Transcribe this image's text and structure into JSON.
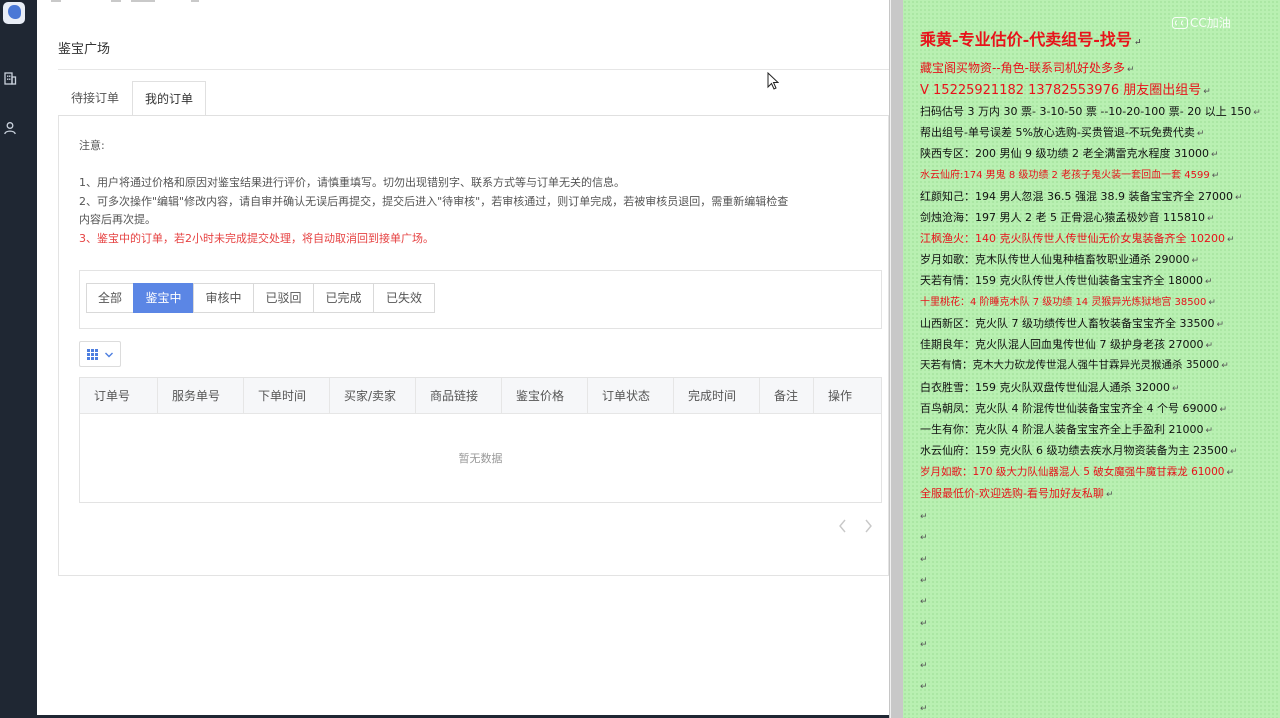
{
  "app": {
    "page_title": "鉴宝广场",
    "tabs": [
      {
        "label": "待接订单",
        "active": false
      },
      {
        "label": "我的订单",
        "active": true
      }
    ]
  },
  "notes": {
    "heading": "注意:",
    "items": [
      {
        "text": "1、用户将通过价格和原因对鉴宝结果进行评价，请慎重填写。切勿出现错别字、联系方式等与订单无关的信息。",
        "color": "#555555"
      },
      {
        "text": "2、可多次操作\"编辑\"修改内容，请自审并确认无误后再提交，提交后进入\"待审核\"，若审核通过，则订单完成，若被审核员退回，需重新编辑检查",
        "color": "#555555"
      },
      {
        "text": "内容后再次提。",
        "color": "#555555"
      },
      {
        "text": "3、鉴宝中的订单，若2小时未完成提交处理，将自动取消回到接单广场。",
        "color": "#e64242"
      }
    ]
  },
  "status_filters": [
    {
      "label": "全部",
      "active": false
    },
    {
      "label": "鉴宝中",
      "active": true
    },
    {
      "label": "审核中",
      "active": false
    },
    {
      "label": "已驳回",
      "active": false
    },
    {
      "label": "已完成",
      "active": false
    },
    {
      "label": "已失效",
      "active": false
    }
  ],
  "table": {
    "columns": [
      "订单号",
      "服务单号",
      "下单时间",
      "买家/卖家",
      "商品链接",
      "鉴宝价格",
      "订单状态",
      "完成时间",
      "备注",
      "操作"
    ],
    "empty_text": "暂无数据"
  },
  "icons": {
    "sidebar": [
      "logo-icon",
      "building-icon",
      "user-icon"
    ],
    "column_toggle": "grid-icon",
    "dropdown": "chevron-down-icon",
    "pager": [
      "chevron-left-icon",
      "chevron-right-icon"
    ]
  },
  "colors": {
    "sidebar_bg": "#1f2733",
    "accent_blue": "#5b86e5",
    "warning_red": "#e64242",
    "notepad_bg": "#b9f0b2",
    "notepad_red": "#e8121a"
  },
  "notepad": {
    "watermark": "CC加油",
    "lines": [
      {
        "text": "乘黄-专业估价-代卖组号-找号",
        "style": "title"
      },
      {
        "text": "藏宝阁买物资--角色-联系司机好处多多",
        "style": "red"
      },
      {
        "text": "V 15225921182   13782553976 朋友圈出组号",
        "style": "phone"
      },
      {
        "text": "扫码估号 3 万内 30 票- 3-10-50 票  --10-20-100 票- 20 以上 150",
        "style": "black"
      },
      {
        "text": "帮出组号-单号误差 5%放心选购-买贵管退-不玩免费代卖",
        "style": "black"
      },
      {
        "text": "陕西专区：200 男仙 9 级功绩 2 老全满雷克水程度 31000",
        "style": "black"
      },
      {
        "text": "水云仙府:174 男鬼 8 级功绩 2 老孩子鬼火装一套回血一套 4599",
        "style": "red"
      },
      {
        "text": "红颜知己：194 男人忽混 36.5 强混 38.9 装备宝宝齐全 27000",
        "style": "black"
      },
      {
        "text": "剑烛沧海：197 男人 2 老 5 正骨混心猿孟极妙音 115810",
        "style": "black"
      },
      {
        "text": "江枫渔火：140 克火队传世人传世仙无价女鬼装备齐全 10200",
        "style": "red"
      },
      {
        "text": "岁月如歌：克木队传世人仙鬼种植畜牧职业通杀 29000",
        "style": "black"
      },
      {
        "text": "天若有情：159 克火队传世人传世仙装备宝宝齐全 18000",
        "style": "black"
      },
      {
        "text": "十里桃花：4 阶睡克木队 7 级功绩 14 灵猴异光炼狱地宫 38500",
        "style": "red"
      },
      {
        "text": "山西新区：克火队 7 级功绩传世人畜牧装备宝宝齐全 33500",
        "style": "black"
      },
      {
        "text": "佳期良年：克火队混人回血鬼传世仙 7 级护身老孩 27000",
        "style": "black"
      },
      {
        "text": "天若有情：克木大力砍龙传世混人强牛甘霖异光灵猴通杀 35000",
        "style": "black"
      },
      {
        "text": "白衣胜雪：159 克火队双盘传世仙混人通杀 32000",
        "style": "black"
      },
      {
        "text": "百鸟朝凤：克火队 4 阶混传世仙装备宝宝齐全 4 个号 69000",
        "style": "black"
      },
      {
        "text": "一生有你：克火队 4 阶混人装备宝宝齐全上手盈利 21000",
        "style": "black"
      },
      {
        "text": "水云仙府：159 克火队 6 级功绩去疾水月物资装备为主 23500",
        "style": "black"
      },
      {
        "text": "岁月如歌：170 级大力队仙器混人 5 破女魔强牛魔甘霖龙 61000",
        "style": "red"
      },
      {
        "text": "全服最低价-欢迎选购-看号加好友私聊",
        "style": "red"
      }
    ],
    "empty_marks": 10
  }
}
